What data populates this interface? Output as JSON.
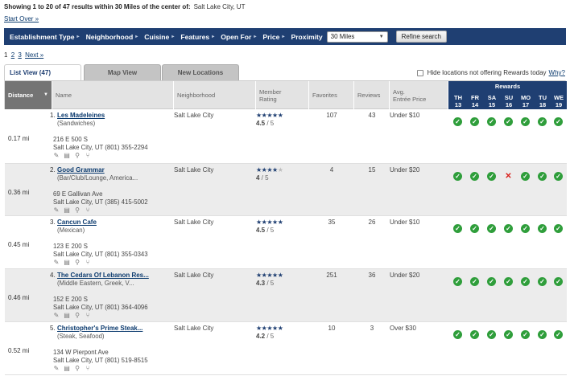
{
  "summary": {
    "text": "Showing 1 to 20 of 47 results within 30 Miles of the center of:",
    "city": "Salt Lake City, UT",
    "start_over": "Start Over »"
  },
  "filters": {
    "items": [
      "Establishment Type",
      "Neighborhood",
      "Cuisine",
      "Features",
      "Open For",
      "Price"
    ],
    "arrow": "▸",
    "proximity_label": "Proximity",
    "proximity_value": "30 Miles",
    "refine_label": "Refine search"
  },
  "pager": {
    "pages": [
      "1",
      "2",
      "3"
    ],
    "next": "Next »"
  },
  "tabs": [
    {
      "label": "List View (47)",
      "active": true
    },
    {
      "label": "Map View",
      "active": false
    },
    {
      "label": "New Locations",
      "active": false
    }
  ],
  "hide_option": {
    "label": "Hide locations not offering Rewards today",
    "why": "Why?"
  },
  "headers": {
    "distance": "Distance",
    "name": "Name",
    "neighborhood": "Neighborhood",
    "rating_line1": "Member",
    "rating_line2": "Rating",
    "favorites": "Favorites",
    "reviews": "Reviews",
    "price_line1": "Avg.",
    "price_line2": "Entrée Price",
    "rewards": "Rewards"
  },
  "days": [
    {
      "abbr": "TH",
      "num": "13"
    },
    {
      "abbr": "FR",
      "num": "14"
    },
    {
      "abbr": "SA",
      "num": "15"
    },
    {
      "abbr": "SU",
      "num": "16"
    },
    {
      "abbr": "MO",
      "num": "17"
    },
    {
      "abbr": "TU",
      "num": "18"
    },
    {
      "abbr": "WE",
      "num": "19"
    }
  ],
  "rows": [
    {
      "num": "1.",
      "name": "Les Madeleines",
      "category": "(Sandwiches)",
      "distance": "0.17 mi",
      "address1": "216 E 500 S",
      "address2": "Salt Lake City, UT (801) 355-2294",
      "neighborhood": "Salt Lake City",
      "rating": 4.5,
      "rating_text": "4.5",
      "rating_of": " / 5",
      "favorites": "107",
      "reviews": "43",
      "price": "Under $10",
      "rewards": [
        true,
        true,
        true,
        true,
        true,
        true,
        true
      ]
    },
    {
      "num": "2.",
      "name": "Good Grammar",
      "category": "(Bar/Club/Lounge, America...",
      "distance": "0.36 mi",
      "address1": "69 E Gallivan Ave",
      "address2": "Salt Lake City, UT (385) 415-5002",
      "neighborhood": "Salt Lake City",
      "rating": 4,
      "rating_text": "4",
      "rating_of": " / 5",
      "favorites": "4",
      "reviews": "15",
      "price": "Under $20",
      "rewards": [
        true,
        true,
        true,
        false,
        true,
        true,
        true
      ]
    },
    {
      "num": "3.",
      "name": "Cancun Cafe",
      "category": "(Mexican)",
      "distance": "0.45 mi",
      "address1": "123 E 200 S",
      "address2": "Salt Lake City, UT (801) 355-0343",
      "neighborhood": "Salt Lake City",
      "rating": 4.5,
      "rating_text": "4.5",
      "rating_of": " / 5",
      "favorites": "35",
      "reviews": "26",
      "price": "Under $10",
      "rewards": [
        true,
        true,
        true,
        true,
        true,
        true,
        true
      ]
    },
    {
      "num": "4.",
      "name": "The Cedars Of Lebanon Res...",
      "category": "(Middle Eastern, Greek, V...",
      "distance": "0.46 mi",
      "address1": "152 E 200 S",
      "address2": "Salt Lake City, UT (801) 364-4096",
      "neighborhood": "Salt Lake City",
      "rating": 4.3,
      "rating_text": "4.3",
      "rating_of": " / 5",
      "favorites": "251",
      "reviews": "36",
      "price": "Under $20",
      "rewards": [
        true,
        true,
        true,
        true,
        true,
        true,
        true
      ]
    },
    {
      "num": "5.",
      "name": "Christopher's Prime Steak...",
      "category": "(Steak, Seafood)",
      "distance": "0.52 mi",
      "address1": "134 W Pierpont Ave",
      "address2": "Salt Lake City, UT (801) 519-8515",
      "neighborhood": "Salt Lake City",
      "rating": 4.2,
      "rating_text": "4.2",
      "rating_of": " / 5",
      "favorites": "10",
      "reviews": "3",
      "price": "Over $30",
      "rewards": [
        true,
        true,
        true,
        true,
        true,
        true,
        true
      ]
    }
  ],
  "icons": [
    "edit-icon",
    "menu-icon",
    "map-pin-icon",
    "utensils-icon"
  ],
  "colors": {
    "brand": "#1f3f72",
    "reward_yes": "#2f9e3b",
    "reward_no": "#d9201b"
  }
}
